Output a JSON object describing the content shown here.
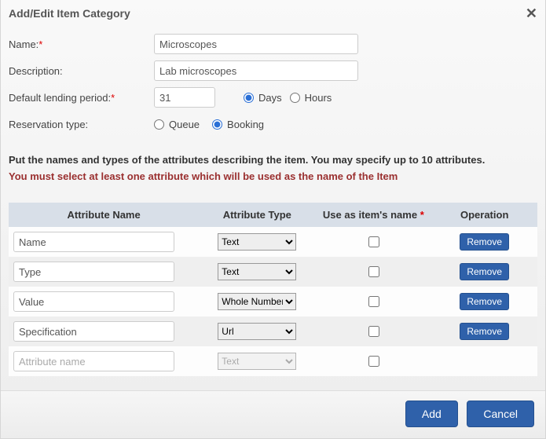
{
  "dialog": {
    "title": "Add/Edit Item Category",
    "close_icon": "✕"
  },
  "fields": {
    "name_label": "Name:",
    "name_value": "Microscopes",
    "description_label": "Description:",
    "description_value": "Lab microscopes",
    "lending_label": "Default lending period:",
    "lending_value": "31",
    "lending_unit_days": "Days",
    "lending_unit_hours": "Hours",
    "reservation_label": "Reservation type:",
    "reservation_queue": "Queue",
    "reservation_booking": "Booking"
  },
  "instructions": "Put the names and types of the attributes describing the item. You may specify up to 10 attributes.",
  "warning": "You must select at least one attribute which will be used as the name of the Item",
  "table": {
    "headers": {
      "name": "Attribute Name",
      "type": "Attribute Type",
      "use": "Use as item's name ",
      "op": "Operation"
    },
    "remove_label": "Remove",
    "placeholder": "Attribute name",
    "rows": [
      {
        "name": "Name",
        "type": "Text"
      },
      {
        "name": "Type",
        "type": "Text"
      },
      {
        "name": "Value",
        "type": "Whole Number"
      },
      {
        "name": "Specification",
        "type": "Url"
      }
    ],
    "new_row_type": "Text"
  },
  "footer": {
    "add": "Add",
    "cancel": "Cancel"
  },
  "required_mark": "*"
}
